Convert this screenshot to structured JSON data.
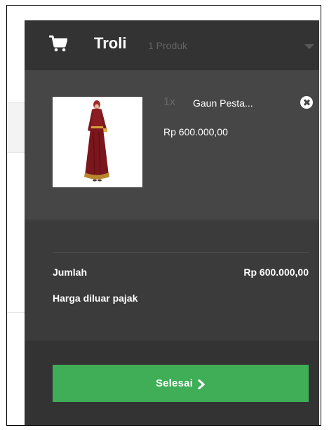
{
  "cart": {
    "title": "Troli",
    "count_label": "1 Produk"
  },
  "item": {
    "quantity": "1x",
    "name": "Gaun Pesta...",
    "price": "Rp 600.000,00",
    "image": "maroon-dress-photo"
  },
  "summary": {
    "total_label": "Jumlah",
    "total_value": "Rp 600.000,00",
    "tax_note": "Harga diluar pajak"
  },
  "checkout": {
    "label": "Selesai"
  },
  "colors": {
    "header_bg": "#333333",
    "panel_bg": "#464646",
    "summary_bg": "#3b3b3b",
    "button_green": "#3fae57",
    "muted_text": "#676767"
  },
  "icons": {
    "cart": "shopping-cart-icon",
    "caret": "chevron-down-icon",
    "remove": "close-circle-icon",
    "checkout": "chevron-right-icon"
  }
}
